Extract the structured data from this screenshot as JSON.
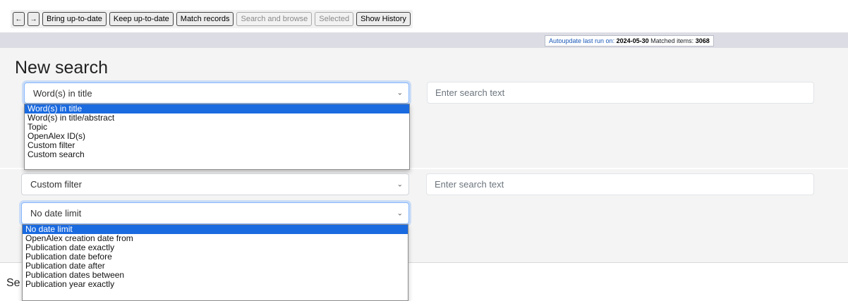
{
  "toolbar": {
    "back_icon": "←",
    "forward_icon": "→",
    "buttons": [
      "Bring up-to-date",
      "Keep up-to-date",
      "Match records",
      "Search and browse",
      "Selected",
      "Show History"
    ]
  },
  "status": {
    "autoupdate_label": "Autoupdate last run on:",
    "autoupdate_date": "2024-05-30",
    "matched_label": "Matched items:",
    "matched_count": "3068"
  },
  "page_title": "New search",
  "search1": {
    "select_value": "Word(s) in title",
    "input_placeholder": "Enter search text",
    "options": [
      "Word(s) in title",
      "Word(s) in title/abstract",
      "Topic",
      "OpenAlex ID(s)",
      "Custom filter",
      "Custom search"
    ]
  },
  "search2": {
    "select_value": "Custom filter",
    "input_placeholder": "Enter search text"
  },
  "date_limit": {
    "select_value": "No date limit",
    "options": [
      "No date limit",
      "OpenAlex creation date from",
      "Publication date exactly",
      "Publication date before",
      "Publication date after",
      "Publication dates between",
      "Publication year exactly"
    ]
  },
  "cut_text": "Se",
  "colors": {
    "accent": "#1a6ae0",
    "focus": "#86b7fe",
    "link": "#1a58b8"
  }
}
